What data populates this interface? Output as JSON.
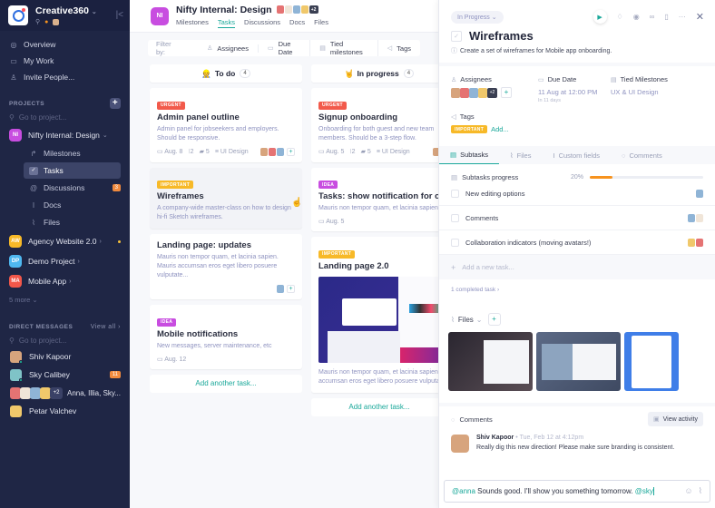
{
  "workspace": {
    "name": "Creative360",
    "logo_color": "#2f6fe0"
  },
  "sidebar": {
    "nav": [
      {
        "icon": "compass-icon",
        "label": "Overview"
      },
      {
        "icon": "calendar-icon",
        "label": "My Work"
      },
      {
        "icon": "add-user-icon",
        "label": "Invite People..."
      }
    ],
    "projects_header": "PROJECTS",
    "project_search_placeholder": "Go to project...",
    "projects": [
      {
        "initials": "NI",
        "name": "Nifty Internal: Design",
        "color": "#c84de0",
        "expanded": true
      },
      {
        "initials": "AW",
        "name": "Agency Website 2.0",
        "color": "#f7b928",
        "unread_dot": true
      },
      {
        "initials": "DP",
        "name": "Demo Project",
        "color": "#4fb8f0"
      },
      {
        "initials": "MA",
        "name": "Mobile App",
        "color": "#f2574a"
      }
    ],
    "project_subnav": [
      {
        "icon": "milestone-icon",
        "label": "Milestones"
      },
      {
        "icon": "check-icon",
        "label": "Tasks",
        "active": true
      },
      {
        "icon": "at-icon",
        "label": "Discussions",
        "badge": "3"
      },
      {
        "icon": "docs-icon",
        "label": "Docs"
      },
      {
        "icon": "paperclip-icon",
        "label": "Files"
      }
    ],
    "more_label": "5 more",
    "dm_header": "DIRECT MESSAGES",
    "dm_view_all": "View all",
    "dm_search_placeholder": "Go to project...",
    "dms": [
      {
        "name": "Shiv Kapoor",
        "online": true
      },
      {
        "name": "Sky Calibey",
        "online": true,
        "badge": "11"
      },
      {
        "name": "Anna, Illia, Sky...",
        "group": true,
        "extra": "+2"
      },
      {
        "name": "Petar Valchev",
        "online": false
      }
    ]
  },
  "header": {
    "project_initials": "NI",
    "project_title": "Nifty Internal: Design",
    "members_extra": "+2",
    "tabs": [
      "Milestones",
      "Tasks",
      "Discussions",
      "Docs",
      "Files"
    ],
    "active_tab": "Tasks"
  },
  "filter": {
    "label": "Filter by:",
    "items": [
      "Assignees",
      "Due Date",
      "Tied milestones",
      "Tags"
    ]
  },
  "columns": [
    {
      "title": "To do",
      "emoji": "👷",
      "count": "4",
      "cards": [
        {
          "tag": "URGENT",
          "title": "Admin panel outline",
          "desc": "Admin panel for jobseekers and employers. Should be responsive.",
          "date": "Aug. 8",
          "subtasks": "2",
          "comments": "5",
          "milestone": "UI Design"
        },
        {
          "tag": "IMPORTANT",
          "title": "Wireframes",
          "desc": "A company-wide master-class on how to design hi-fi Sketch wireframes."
        },
        {
          "title": "Landing page: updates",
          "desc": "Mauris non tempor quam, et lacinia sapien. Mauris accumsan eros eget libero posuere vulputate..."
        },
        {
          "tag": "IDEA",
          "title": "Mobile notifications",
          "desc": "New messages, server maintenance, etc",
          "date": "Aug. 12"
        }
      ],
      "add_label": "Add another task..."
    },
    {
      "title": "In progress",
      "emoji": "🤘",
      "count": "4",
      "cards": [
        {
          "tag": "URGENT",
          "title": "Signup onboarding",
          "desc": "Onboarding for both guest and new team members. Should be a 3-step flow.",
          "date": "Aug. 5",
          "subtasks": "2",
          "comments": "5",
          "milestone": "UI Design"
        },
        {
          "tag": "IDEA",
          "title": "Tasks: show notification for comm",
          "desc": "Mauris non tempor quam, et lacinia sapien.",
          "date": "Aug. 5"
        },
        {
          "tag": "IMPORTANT",
          "title": "Landing page 2.0",
          "desc": "Mauris non tempor quam, et lacinia sapien. accumsan eros eget libero posuere vulputa"
        }
      ],
      "add_label": "Add another task..."
    }
  ],
  "detail": {
    "status": "In Progress",
    "title": "Wireframes",
    "description": "Create a set of wireframes for Mobile app onboarding.",
    "assignees_label": "Assignees",
    "assignees_extra": "+2",
    "due_label": "Due Date",
    "due_value": "11 Aug at 12:00 PM",
    "due_relative": "In 11 days",
    "milestone_label": "Tied Milestones",
    "milestone_value": "UX & UI Design",
    "tags_label": "Tags",
    "tag": "IMPORTANT",
    "tag_add": "Add...",
    "tabs": [
      "Subtasks",
      "Files",
      "Custom fields",
      "Comments"
    ],
    "active_tab": "Subtasks",
    "progress_label": "Subtasks progress",
    "progress_percent": 20,
    "progress_text": "20%",
    "subtasks": [
      {
        "label": "New editing options"
      },
      {
        "label": "Comments"
      },
      {
        "label": "Collaboration indicators (moving avatars!)"
      }
    ],
    "add_subtask_placeholder": "Add a new task...",
    "completed_label": "1 completed task",
    "files_label": "Files",
    "comments_label": "Comments",
    "view_activity": "View activity",
    "comment": {
      "author": "Shiv Kapoor",
      "time": "Tue, Feb 12 at 4:12pm",
      "text": "Really dig this new direction! Please make sure branding is consistent."
    },
    "reply": {
      "mention1": "@anna",
      "text": " Sounds good. I'll show you something tomorrow. ",
      "mention2": "@sky"
    }
  }
}
